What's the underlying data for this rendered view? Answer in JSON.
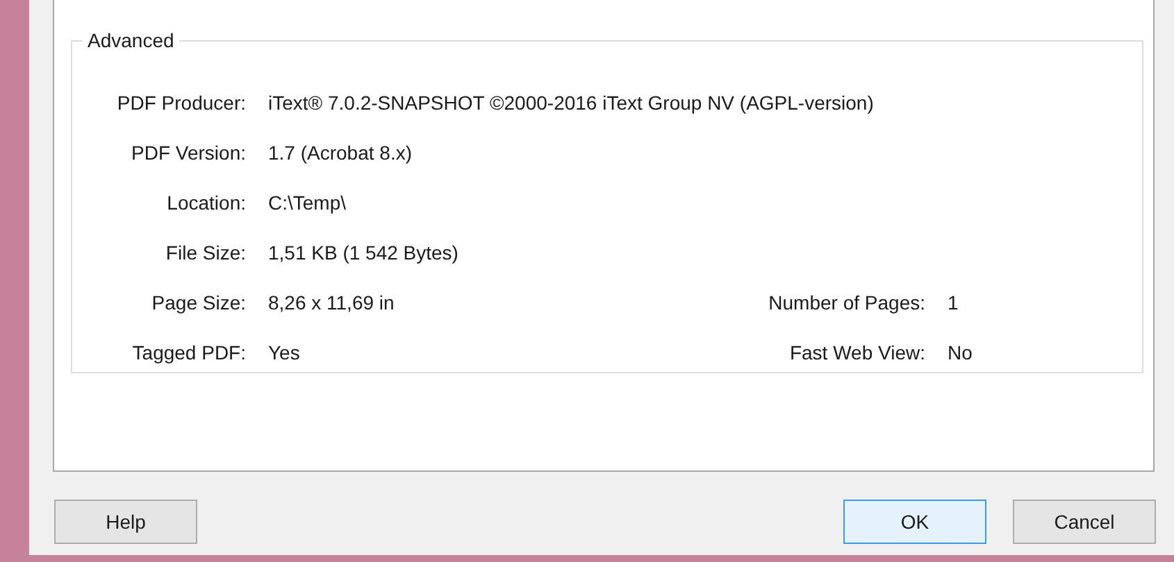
{
  "group": {
    "title": "Advanced"
  },
  "rows": [
    {
      "label": "PDF Producer:",
      "value": "iText® 7.0.2-SNAPSHOT ©2000-2016 iText Group NV (AGPL-version)"
    },
    {
      "label": "PDF Version:",
      "value": "1.7 (Acrobat 8.x)"
    },
    {
      "label": "Location:",
      "value": "C:\\Temp\\"
    },
    {
      "label": "File Size:",
      "value": "1,51 KB (1 542 Bytes)"
    },
    {
      "label": "Page Size:",
      "value": "8,26 x 11,69 in",
      "right": {
        "label": "Number of Pages:",
        "value": "1"
      }
    },
    {
      "label": "Tagged PDF:",
      "value": "Yes",
      "right": {
        "label": "Fast Web View:",
        "value": "No"
      }
    }
  ],
  "buttons": [
    {
      "label": "Help",
      "default": false
    },
    {
      "label": "OK",
      "default": true
    },
    {
      "label": "Cancel",
      "default": false
    }
  ]
}
